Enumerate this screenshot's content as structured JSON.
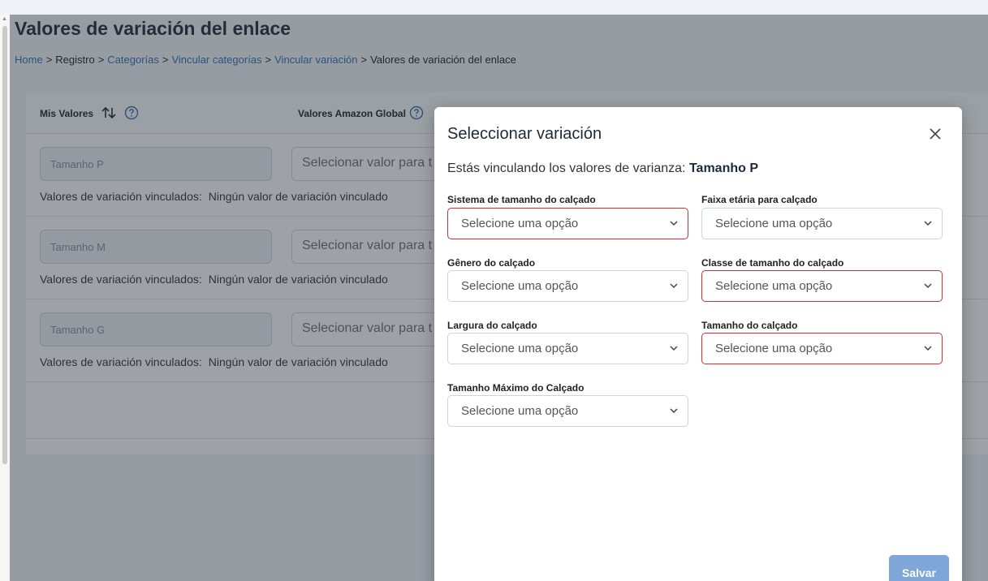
{
  "page": {
    "title": "Valores de variación del enlace",
    "breadcrumb": [
      {
        "label": "Home",
        "link": true
      },
      {
        "label": "Registro",
        "link": false
      },
      {
        "label": "Categorías",
        "link": true
      },
      {
        "label": "Vincular categorías",
        "link": true
      },
      {
        "label": "Vincular variación",
        "link": true
      },
      {
        "label": "Valores de variación del enlace",
        "link": false
      }
    ],
    "separator": ">"
  },
  "table": {
    "col_my_values": "Mis Valores",
    "col_amazon_values": "Valores Amazon Global",
    "rows": [
      {
        "my_value": "Tamanho P",
        "select_placeholder": "Selecionar valor para t",
        "linked_label": "Valores de variación vinculados:",
        "linked_value": "Ningún valor de variación vinculado"
      },
      {
        "my_value": "Tamanho M",
        "select_placeholder": "Selecionar valor para t",
        "linked_label": "Valores de variación vinculados:",
        "linked_value": "Ningún valor de variación vinculado"
      },
      {
        "my_value": "Tamanho G",
        "select_placeholder": "Selecionar valor para t",
        "linked_label": "Valores de variación vinculados:",
        "linked_value": "Ningún valor de variación vinculado"
      }
    ]
  },
  "modal": {
    "title": "Seleccionar variación",
    "subtitle_prefix": "Estás vinculando los valores de varianza:",
    "subtitle_value": "Tamanho P",
    "fields": [
      {
        "label": "Sistema de tamanho do calçado",
        "value": "Selecione uma opção",
        "invalid": true
      },
      {
        "label": "Faixa etária para calçado",
        "value": "Selecione uma opção",
        "invalid": false
      },
      {
        "label": "Gênero do calçado",
        "value": "Selecione uma opção",
        "invalid": false
      },
      {
        "label": "Classe de tamanho do calçado",
        "value": "Selecione uma opção",
        "invalid": true
      },
      {
        "label": "Largura do calçado",
        "value": "Selecione uma opção",
        "invalid": false
      },
      {
        "label": "Tamanho do calçado",
        "value": "Selecione uma opção",
        "invalid": true
      },
      {
        "label": "Tamanho Máximo do Calçado",
        "value": "Selecione uma opção",
        "invalid": false
      }
    ],
    "save_label": "Salvar"
  },
  "colors": {
    "link": "#2f6fb5",
    "invalid_border": "#c0333a",
    "save_button": "#7fa6d9",
    "overlay": "#28303c"
  },
  "icons": {
    "sort": "sort-arrows-icon",
    "help": "question-circle-icon",
    "close": "close-icon",
    "chevron": "chevron-down-icon"
  }
}
